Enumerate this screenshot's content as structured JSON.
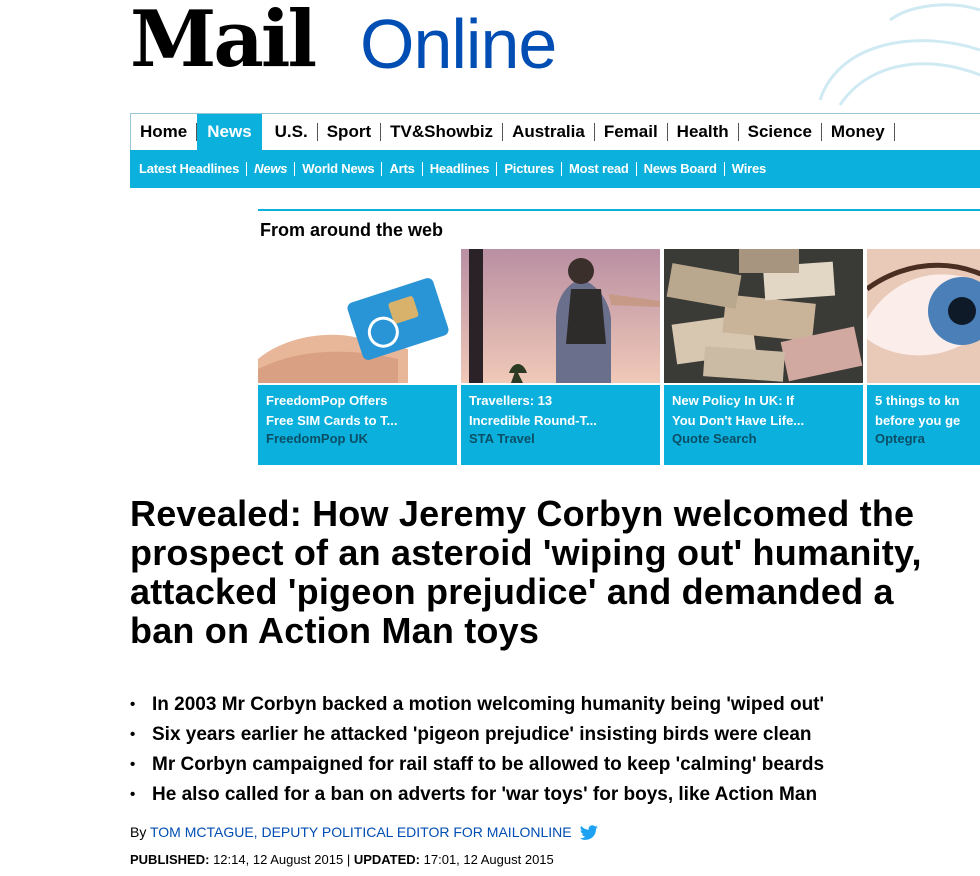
{
  "logo": {
    "mail": "Mail",
    "online": "Online"
  },
  "nav": {
    "primary": [
      "Home",
      "News",
      "U.S.",
      "Sport",
      "TV&Showbiz",
      "Australia",
      "Femail",
      "Health",
      "Science",
      "Money"
    ],
    "active": "News",
    "secondary": [
      "Latest Headlines",
      "News",
      "World News",
      "Arts",
      "Headlines",
      "Pictures",
      "Most read",
      "News Board",
      "Wires"
    ]
  },
  "web": {
    "heading": "From around the web",
    "cards": [
      {
        "title": "FreedomPop Offers\nFree SIM Cards to T...",
        "source": "FreedomPop UK"
      },
      {
        "title": "Travellers: 13\nIncredible Round-T...",
        "source": "STA Travel"
      },
      {
        "title": "New Policy In UK: If\nYou Don't Have Life...",
        "source": "Quote Search"
      },
      {
        "title": "5 things to kn\nbefore you ge",
        "source": "Optegra"
      }
    ]
  },
  "article": {
    "headline": "Revealed: How Jeremy Corbyn welcomed the prospect of an asteroid 'wiping out' humanity, attacked 'pigeon prejudice' and demanded a ban on Action Man toys",
    "bullets": [
      "In 2003 Mr Corbyn backed a motion welcoming humanity being 'wiped out'",
      "Six years earlier he attacked 'pigeon prejudice' insisting birds were clean",
      "Mr Corbyn campaigned for rail staff to be allowed to keep 'calming' beards",
      "He also called for a ban on adverts for 'war toys' for boys, like Action Man"
    ],
    "byline_prefix": "By",
    "author": "TOM MCTAGUE, DEPUTY POLITICAL EDITOR FOR MAILONLINE",
    "published_label": "PUBLISHED:",
    "published": "12:14, 12 August 2015",
    "updated_label": "UPDATED:",
    "updated": "17:01, 12 August 2015"
  },
  "colors": {
    "accent": "#0cb0dd",
    "brand_blue": "#004db3"
  }
}
